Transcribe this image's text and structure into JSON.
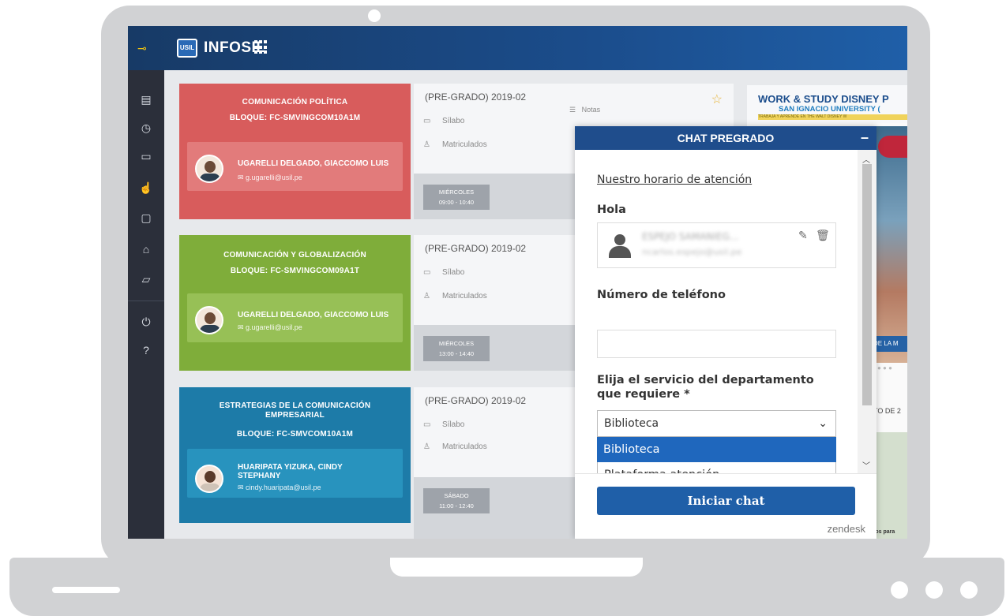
{
  "app": {
    "brand": "INFOSIL",
    "logo_text": "USIL"
  },
  "sidebar": {
    "icons": [
      "document-icon",
      "clock-icon",
      "inbox-icon",
      "hand-icon",
      "monitor-icon",
      "graduation-cap-icon",
      "folder-icon",
      "power-icon",
      "help-icon"
    ]
  },
  "courses": [
    {
      "color": "#d85c5c",
      "prof_bg": "#e27b7b",
      "title": "COMUNICACIÓN POLÍTICA",
      "title2": "",
      "block": "BLOQUE: FC-SMVINGCOM10A1M",
      "prof": "UGARELLI DELGADO, GIACCOMO LUIS",
      "prof2": "",
      "email": "✉ g.ugarelli@usil.pe",
      "period": "(PRE-GRADO) 2019-02",
      "syllabus": "Sílabo",
      "enrolled": "Matriculados",
      "day": "MIÉRCOLES",
      "time": "09:00 - 10:40",
      "notes": "Notas"
    },
    {
      "color": "#7fad3a",
      "prof_bg": "#97c056",
      "title": "COMUNICACIÓN Y GLOBALIZACIÓN",
      "title2": "",
      "block": "BLOQUE: FC-SMVINGCOM09A1T",
      "prof": "UGARELLI DELGADO, GIACCOMO LUIS",
      "prof2": "",
      "email": "✉ g.ugarelli@usil.pe",
      "period": "(PRE-GRADO) 2019-02",
      "syllabus": "Sílabo",
      "enrolled": "Matriculados",
      "day": "MIÉRCOLES",
      "time": "13:00 - 14:40"
    },
    {
      "color": "#1d7ba8",
      "prof_bg": "#2893be",
      "title": "ESTRATEGIAS DE LA COMUNICACIÓN",
      "title2": "EMPRESARIAL",
      "block": "BLOQUE: FC-SMVCOM10A1M",
      "prof": "HUARIPATA YIZUKA, CINDY",
      "prof2": "STEPHANY",
      "email": "✉ cindy.huaripata@usil.pe",
      "period": "(PRE-GRADO) 2019-02",
      "syllabus": "Sílabo",
      "enrolled": "Matriculados",
      "day": "SÁBADO",
      "time": "11:00 - 12:40"
    }
  ],
  "banner": {
    "line1": "WORK & STUDY DISNEY P",
    "line2": "SAN IGNACIO UNIVERSITY (",
    "line3": "TRABAJA Y APRENDE EN THE WALT DISNEY W",
    "strip": "DE LA M",
    "date": "TO DE 2",
    "foot": "tos para"
  },
  "chat": {
    "title": "CHAT PREGRADO",
    "minimize": "–",
    "hours_link": "Nuestro horario de atención",
    "greeting": "Hola",
    "contact_name": "ESPEJO SAMANIEG...",
    "contact_email": "ncarlos.espejo@usil.pe",
    "phone_label": "Número de teléfono",
    "phone_value": "",
    "service_label_1": "Elija el servicio del departamento",
    "service_label_2": "que requiere *",
    "service_selected": "Biblioteca",
    "service_options": [
      "Biblioteca",
      "Plataforma atención"
    ],
    "start_button": "Iniciar chat",
    "powered_by": "zendesk"
  }
}
